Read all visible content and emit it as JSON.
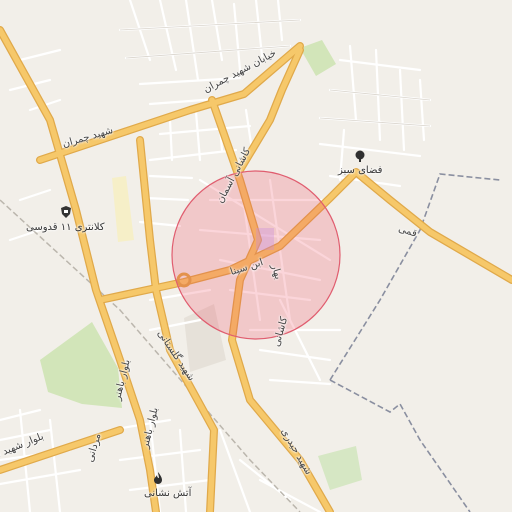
{
  "map": {
    "colors": {
      "background": "#f2efe9",
      "major_road": "#f6c86a",
      "major_road_casing": "#e0a94a",
      "minor_road": "#ffffff",
      "street_casing": "#cfcac2",
      "park": "#d2e5b9",
      "boundary": "#8a8fa0",
      "highlight_fill": "rgba(236,64,88,0.22)",
      "highlight_stroke": "#e05d6f"
    },
    "labels": {
      "road_chamran_ne": "خیابان شهید چمران",
      "road_chamran_w": "شهید چمران",
      "road_kashani_n": "کاشانی آسمان",
      "road_ibn_sina": "ابن سینا",
      "road_bahar": "بهار",
      "road_kashani_s": "کاشانی",
      "road_golestani": "شهید گلستانی",
      "road_bahonar_1": "بلوار باهنر",
      "road_bahonar_2": "بلوار باهنر",
      "road_heydari": "شهید حیدری",
      "road_mardani": "مردانی",
      "road_qomi": "قمی",
      "road_blvd_sw": "بلوار شهید ا",
      "poi_police": "کلانتری ۱۱ قدوسی",
      "poi_green_space": "فضای سبز",
      "poi_fire_station": "آتش نشانی"
    },
    "icons": {
      "police": "police-icon",
      "tree": "tree-icon",
      "fire": "fire-station-icon",
      "roundabout": "roundabout-icon"
    }
  }
}
